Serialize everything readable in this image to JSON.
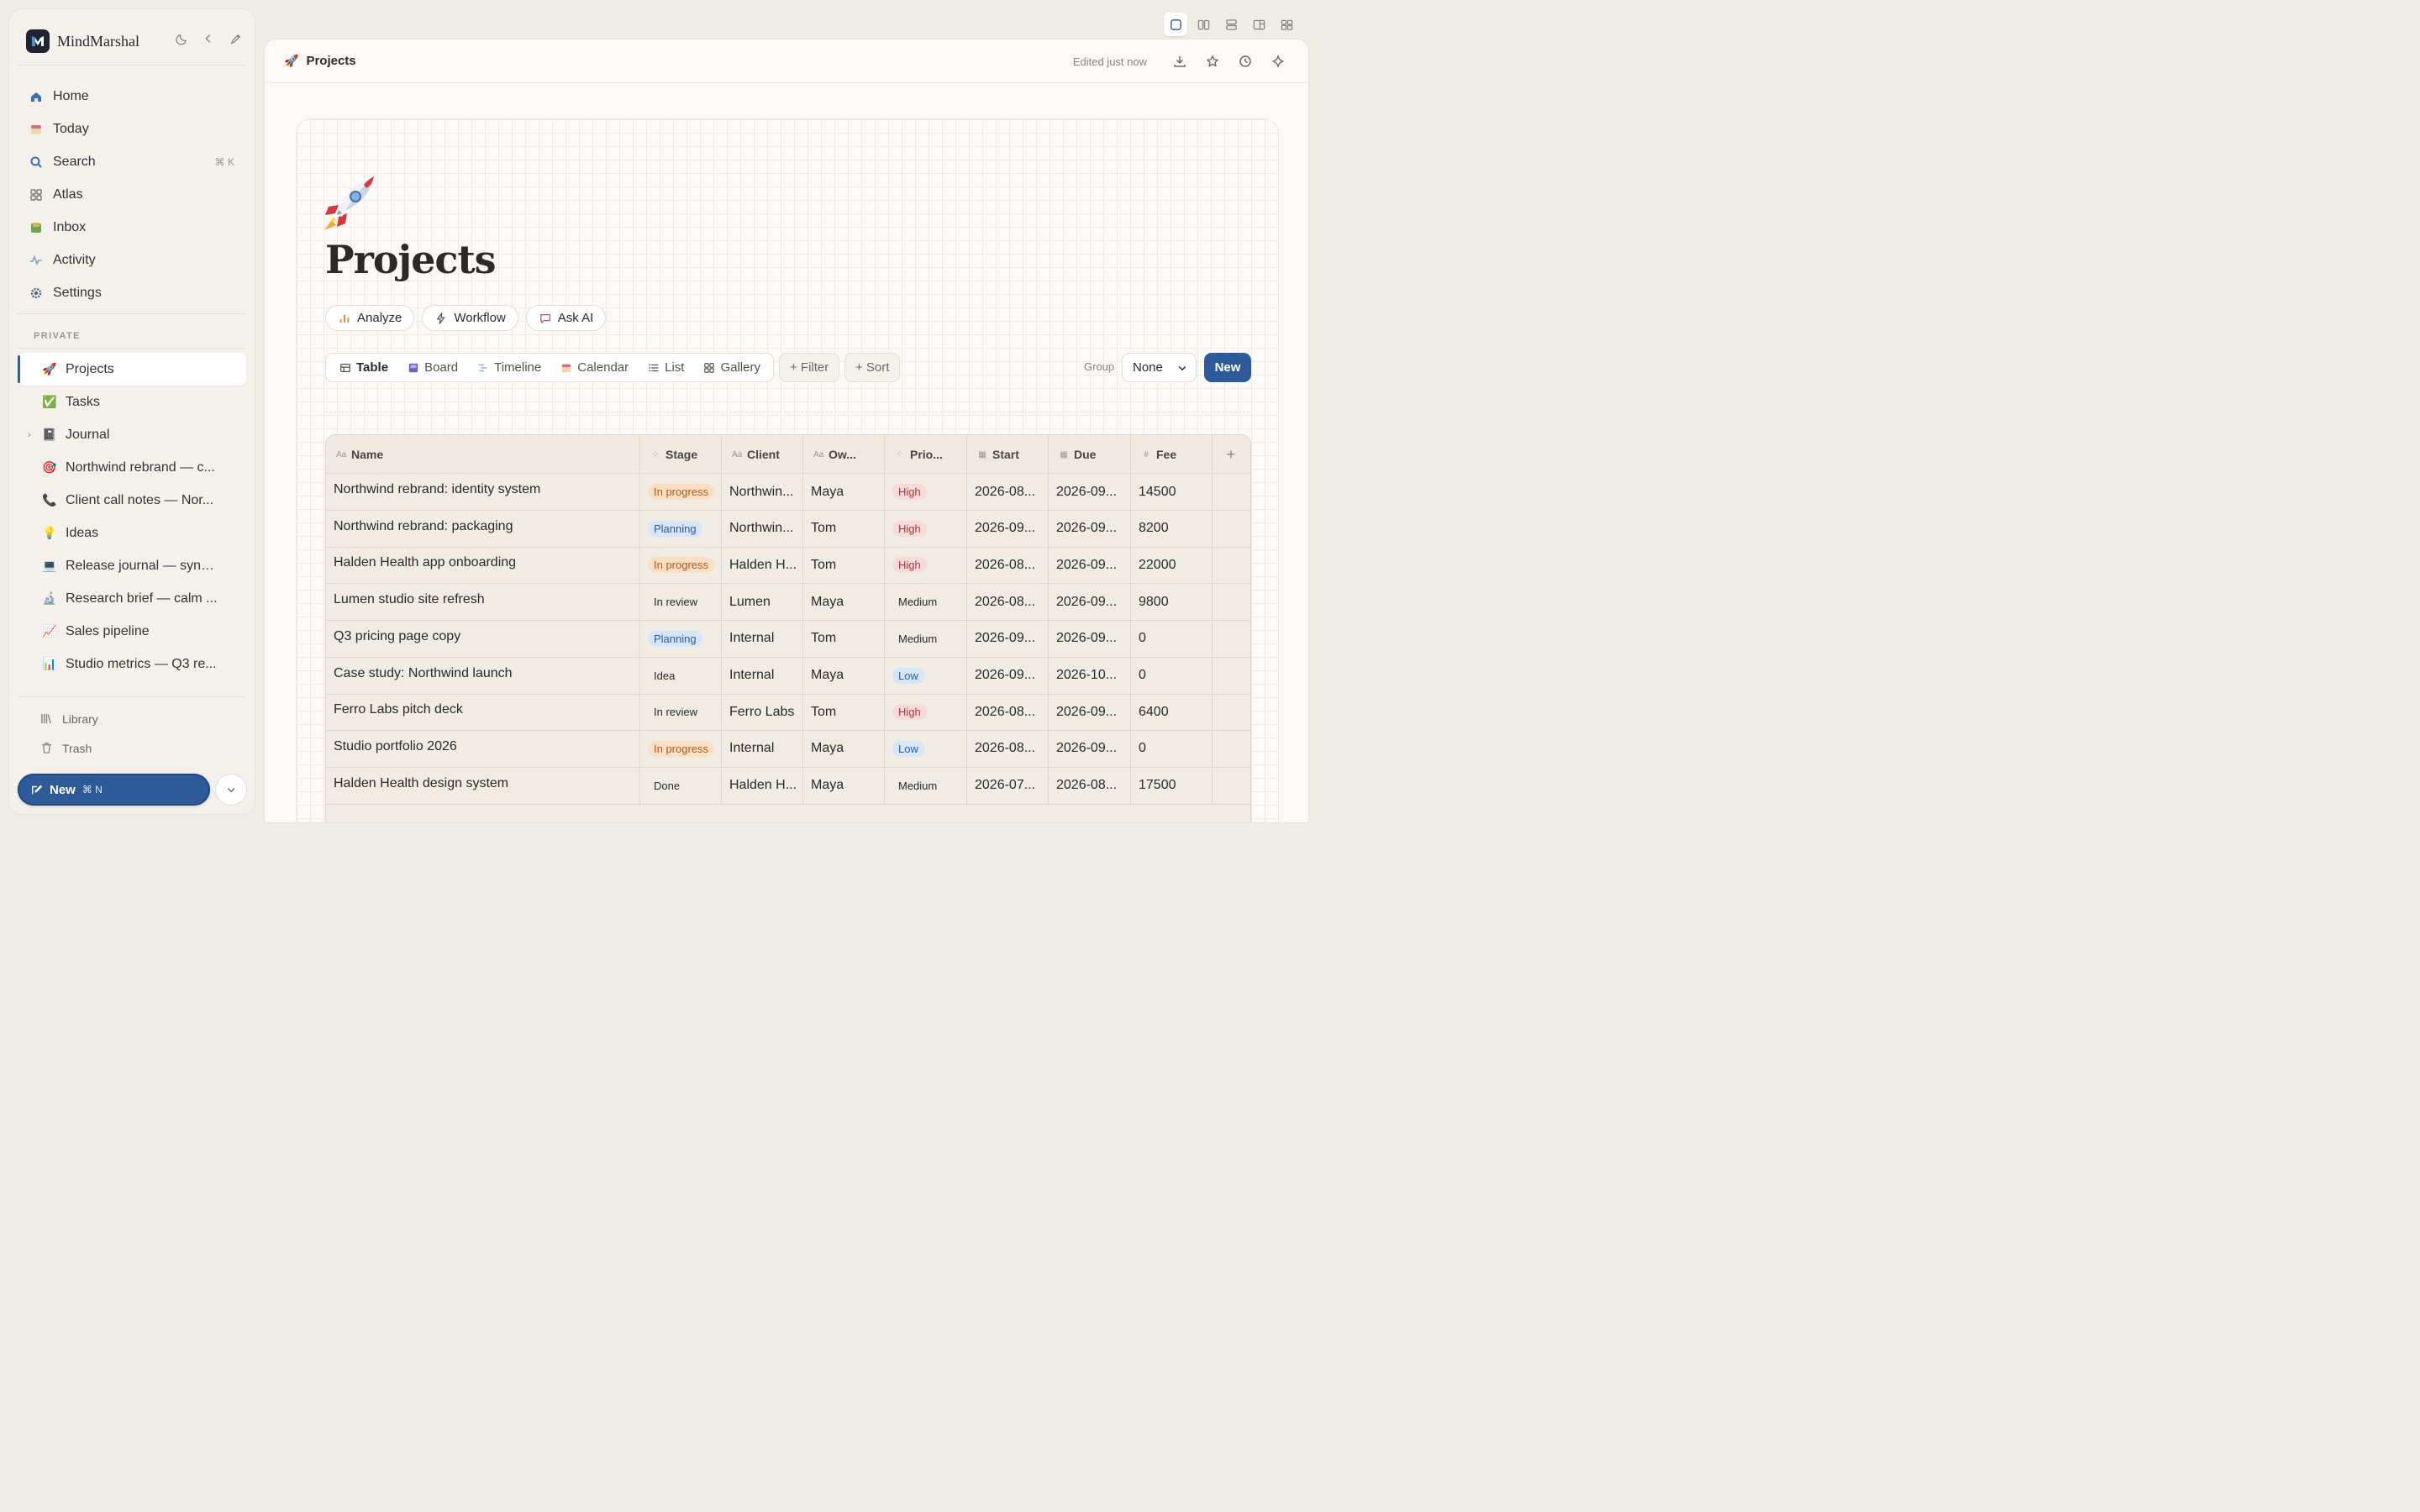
{
  "app": {
    "name": "MindMarshal"
  },
  "sidebar": {
    "nav": [
      {
        "label": "Home",
        "icon": "home-icon"
      },
      {
        "label": "Today",
        "icon": "calendar-icon"
      },
      {
        "label": "Search",
        "icon": "search-icon",
        "shortcut": "⌘ K"
      },
      {
        "label": "Atlas",
        "icon": "grid-icon"
      },
      {
        "label": "Inbox",
        "icon": "inbox-icon"
      },
      {
        "label": "Activity",
        "icon": "pulse-icon"
      },
      {
        "label": "Settings",
        "icon": "gear-icon"
      }
    ],
    "section_title": "PRIVATE",
    "pages": [
      {
        "emoji": "🚀",
        "label": "Projects",
        "active": true
      },
      {
        "emoji": "✅",
        "label": "Tasks"
      },
      {
        "emoji": "📓",
        "label": "Journal",
        "expandable": true
      },
      {
        "emoji": "🎯",
        "label": "Northwind rebrand — c..."
      },
      {
        "emoji": "📞",
        "label": "Client call notes — Nor..."
      },
      {
        "emoji": "💡",
        "label": "Ideas"
      },
      {
        "emoji": "💻",
        "label": "Release journal — sync..."
      },
      {
        "emoji": "🔬",
        "label": "Research brief — calm ..."
      },
      {
        "emoji": "📈",
        "label": "Sales pipeline"
      },
      {
        "emoji": "📊",
        "label": "Studio metrics — Q3 re..."
      }
    ],
    "footer": [
      {
        "label": "Library",
        "icon": "library-icon"
      },
      {
        "label": "Trash",
        "icon": "trash-icon"
      }
    ],
    "new_button": {
      "label": "New",
      "shortcut": "⌘ N"
    }
  },
  "topbar": {
    "breadcrumb_emoji": "🚀",
    "breadcrumb": "Projects",
    "edited": "Edited just now"
  },
  "page": {
    "title": "Projects",
    "actions": [
      {
        "label": "Analyze",
        "icon": "bar-chart-icon"
      },
      {
        "label": "Workflow",
        "icon": "lightning-icon"
      },
      {
        "label": "Ask AI",
        "icon": "chat-icon"
      }
    ],
    "views": [
      {
        "label": "Table",
        "icon": "table-icon",
        "active": true
      },
      {
        "label": "Board",
        "icon": "board-icon"
      },
      {
        "label": "Timeline",
        "icon": "timeline-icon"
      },
      {
        "label": "Calendar",
        "icon": "calendar-icon"
      },
      {
        "label": "List",
        "icon": "list-icon"
      },
      {
        "label": "Gallery",
        "icon": "gallery-icon"
      }
    ],
    "filter_label": "+ Filter",
    "sort_label": "+ Sort",
    "group_label": "Group",
    "group_value": "None",
    "new_label": "New"
  },
  "table": {
    "columns": [
      {
        "label": "Name",
        "icon": "Aa"
      },
      {
        "label": "Stage",
        "icon": "⁘"
      },
      {
        "label": "Client",
        "icon": "Aa"
      },
      {
        "label": "Ow...",
        "icon": "Aa"
      },
      {
        "label": "Prio...",
        "icon": "⁘"
      },
      {
        "label": "Start",
        "icon": "▦"
      },
      {
        "label": "Due",
        "icon": "▦"
      },
      {
        "label": "Fee",
        "icon": "#"
      },
      {
        "label": "+",
        "icon": ""
      }
    ],
    "rows": [
      {
        "name": "Northwind rebrand: identity system",
        "stage": "In progress",
        "client": "Northwin...",
        "owner": "Maya",
        "priority": "High",
        "start": "2026-08...",
        "due": "2026-09...",
        "fee": "14500"
      },
      {
        "name": "Northwind rebrand: packaging",
        "stage": "Planning",
        "client": "Northwin...",
        "owner": "Tom",
        "priority": "High",
        "start": "2026-09...",
        "due": "2026-09...",
        "fee": "8200"
      },
      {
        "name": "Halden Health app onboarding",
        "stage": "In progress",
        "client": "Halden H...",
        "owner": "Tom",
        "priority": "High",
        "start": "2026-08...",
        "due": "2026-09...",
        "fee": "22000"
      },
      {
        "name": "Lumen studio site refresh",
        "stage": "In review",
        "client": "Lumen",
        "owner": "Maya",
        "priority": "Medium",
        "start": "2026-08...",
        "due": "2026-09...",
        "fee": "9800"
      },
      {
        "name": "Q3 pricing page copy",
        "stage": "Planning",
        "client": "Internal",
        "owner": "Tom",
        "priority": "Medium",
        "start": "2026-09...",
        "due": "2026-09...",
        "fee": "0"
      },
      {
        "name": "Case study: Northwind launch",
        "stage": "Idea",
        "client": "Internal",
        "owner": "Maya",
        "priority": "Low",
        "start": "2026-09...",
        "due": "2026-10...",
        "fee": "0"
      },
      {
        "name": "Ferro Labs pitch deck",
        "stage": "In review",
        "client": "Ferro Labs",
        "owner": "Tom",
        "priority": "High",
        "start": "2026-08...",
        "due": "2026-09...",
        "fee": "6400"
      },
      {
        "name": "Studio portfolio 2026",
        "stage": "In progress",
        "client": "Internal",
        "owner": "Maya",
        "priority": "Low",
        "start": "2026-08...",
        "due": "2026-09...",
        "fee": "0"
      },
      {
        "name": "Halden Health design system",
        "stage": "Done",
        "client": "Halden H...",
        "owner": "Maya",
        "priority": "Medium",
        "start": "2026-07...",
        "due": "2026-08...",
        "fee": "17500"
      }
    ]
  },
  "colors": {
    "accent": "#2d5b9a",
    "background": "#efece6"
  }
}
